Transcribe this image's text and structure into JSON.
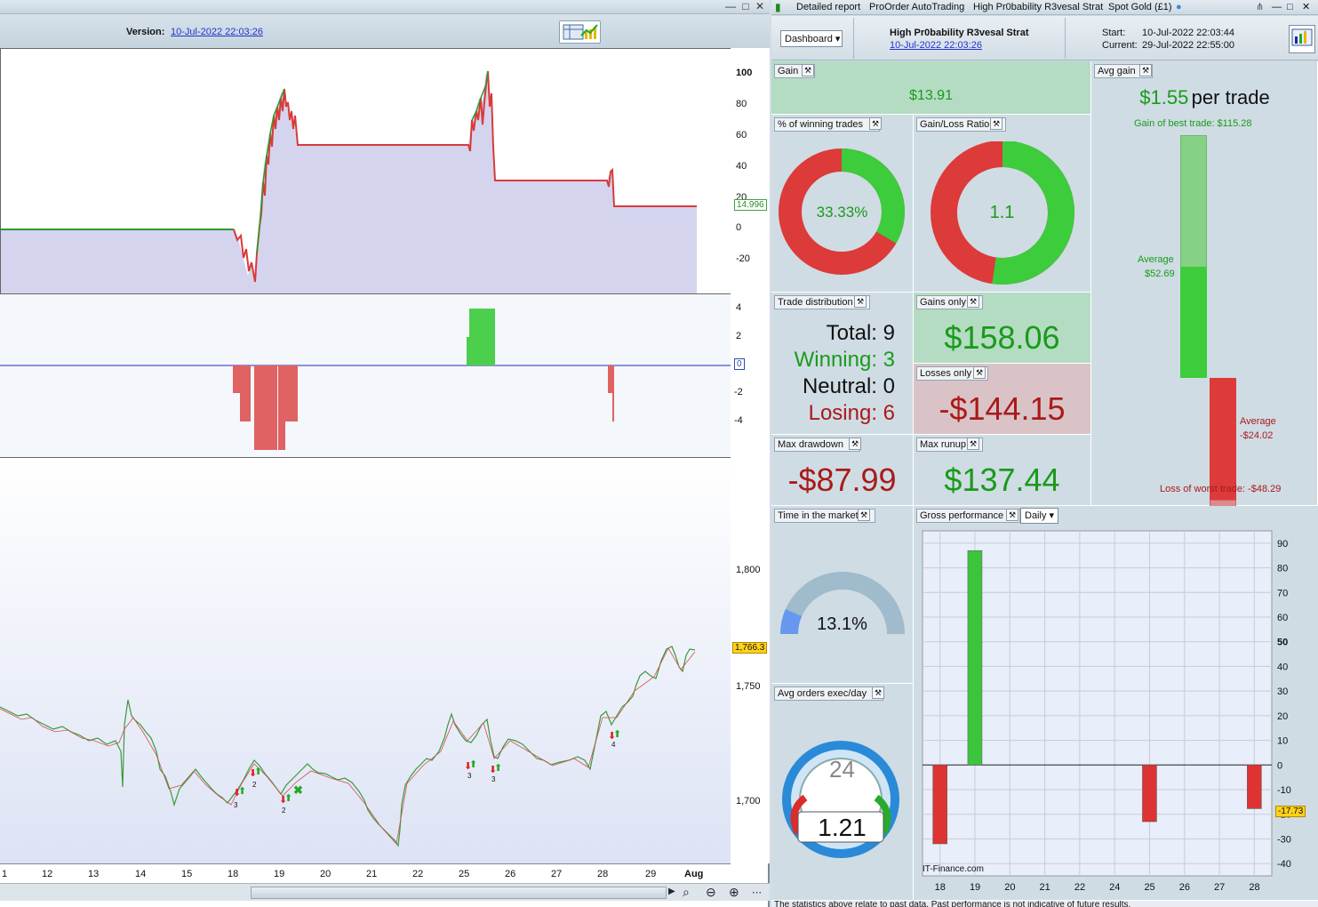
{
  "left": {
    "version_label": "Version:",
    "version_date": "10-Jul-2022 22:03:26",
    "equity_yticks": [
      "100",
      "80",
      "60",
      "40",
      "20",
      "0",
      "-20"
    ],
    "equity_tag": "14.996",
    "pos_yticks": [
      "4",
      "2",
      "0",
      "-2",
      "-4"
    ],
    "pos_tag": "0",
    "price_yticks": [
      "1,800",
      "1,750",
      "1,700"
    ],
    "price_tag": "1,766.3",
    "xlabels": [
      "1",
      "12",
      "13",
      "14",
      "15",
      "18",
      "19",
      "20",
      "21",
      "22",
      "25",
      "26",
      "27",
      "28",
      "29",
      "Aug"
    ],
    "trade_marks": [
      "3",
      "2",
      "2",
      "3",
      "3",
      "4"
    ],
    "window_controls": [
      "—",
      "□",
      "✕"
    ]
  },
  "right": {
    "tabs": [
      "Detailed report",
      "ProOrder AutoTrading",
      "High Pr0bability R3vesal Strat",
      "Spot Gold (£1)"
    ],
    "window_controls": [
      "—",
      "□",
      "✕"
    ],
    "dashboard_btn": "Dashboard ▾",
    "strategy_name": "High Pr0bability R3vesal Strat",
    "strategy_date": "10-Jul-2022 22:03:26",
    "start_label": "Start:",
    "start_value": "10-Jul-2022 22:03:44",
    "current_label": "Current:",
    "current_value": "29-Jul-2022 22:55:00",
    "gain": {
      "title": "Gain",
      "value": "$13.91"
    },
    "avg_gain": {
      "title": "Avg gain",
      "value": "$1.55",
      "suffix": "per trade",
      "best_label": "Gain of best trade: $115.28",
      "avg_pos_label": "Average",
      "avg_pos_value": "$52.69",
      "avg_neg_label": "Average",
      "avg_neg_value": "-$24.02",
      "worst_label": "Loss of worst trade: -$48.29",
      "best": 115.28,
      "avg_pos": 52.69,
      "avg_neg": -24.02,
      "worst": -48.29
    },
    "win_pct": {
      "title": "% of winning trades",
      "value": "33.33%",
      "fraction": 0.3333
    },
    "gain_loss": {
      "title": "Gain/Loss Ratio",
      "value": "1.1",
      "fraction": 0.523
    },
    "trade_dist": {
      "title": "Trade distribution",
      "total": "Total: 9",
      "winning": "Winning: 3",
      "neutral": "Neutral: 0",
      "losing": "Losing: 6"
    },
    "gains_only": {
      "title": "Gains only",
      "value": "$158.06"
    },
    "losses_only": {
      "title": "Losses only",
      "value": "-$144.15"
    },
    "max_drawdown": {
      "title": "Max drawdown",
      "value": "-$87.99"
    },
    "max_runup": {
      "title": "Max runup",
      "value": "$137.44"
    },
    "time_market": {
      "title": "Time in the market",
      "value": "13.1%",
      "fraction": 0.131
    },
    "avg_orders": {
      "title": "Avg orders exec/day",
      "value": "1.21",
      "clock": "24"
    },
    "gross_perf": {
      "title": "Gross performance",
      "period": "Daily ▾",
      "watermark": "IT-Finance.com",
      "tag": "-17.73"
    },
    "footer": "The statistics above relate to past data. Past performance is not indicative of future results."
  },
  "chart_data": [
    {
      "type": "bar",
      "title": "Gross performance",
      "categories": [
        "18",
        "19",
        "20",
        "21",
        "22",
        "24",
        "25",
        "26",
        "27",
        "28"
      ],
      "values": [
        -32,
        87,
        0,
        0,
        0,
        0,
        -23,
        0,
        0,
        -17.73
      ],
      "ylim": [
        -45,
        95
      ],
      "yticks": [
        90,
        80,
        70,
        60,
        50,
        40,
        30,
        20,
        10,
        0,
        -10,
        -20,
        -30,
        -40
      ],
      "colors": {
        "positive": "#3dc43d",
        "negative": "#dd3333"
      },
      "grid": true
    }
  ]
}
